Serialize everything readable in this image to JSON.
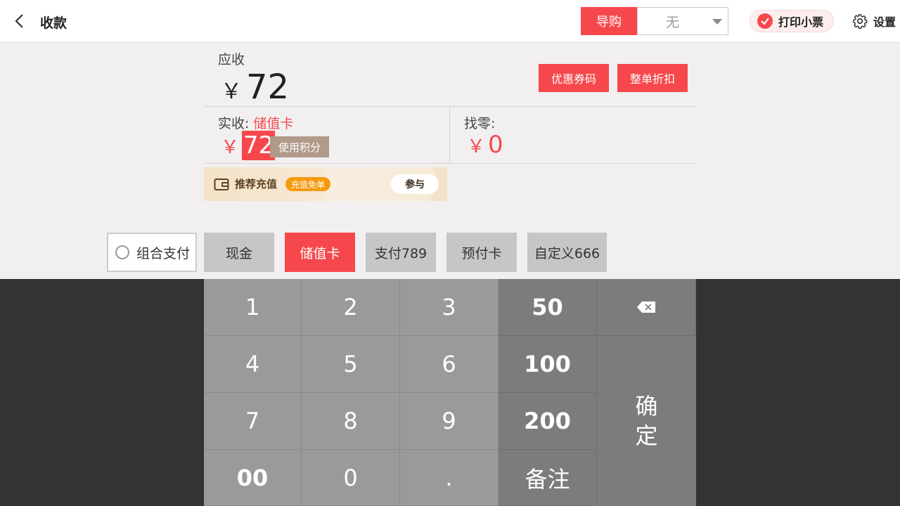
{
  "header": {
    "title": "收款",
    "guide_label": "导购",
    "guide_value": "无",
    "print_label": "打印小票",
    "settings_label": "设置"
  },
  "summary": {
    "receivable_label": "应收",
    "currency": "￥",
    "receivable_amount": "72",
    "coupon_button": "优惠券码",
    "discount_button": "整单折扣",
    "actual_label": "实收:",
    "actual_method": "储值卡",
    "actual_amount": "72",
    "points_button": "使用积分",
    "change_label": "找零:",
    "change_amount": "0"
  },
  "promo": {
    "title": "推荐充值",
    "badge": "充值免单",
    "join_button": "参与"
  },
  "payment": {
    "combo_label": "组合支付",
    "methods": [
      "现金",
      "储值卡",
      "支付789",
      "预付卡",
      "自定义666"
    ],
    "active": "储值卡"
  },
  "keypad": {
    "digits": [
      "1",
      "2",
      "3",
      "4",
      "5",
      "6",
      "7",
      "8",
      "9",
      "00",
      "0",
      "."
    ],
    "quick": [
      "50",
      "100",
      "200"
    ],
    "note": "备注",
    "confirm": "确定"
  },
  "colors": {
    "accent": "#f6484c",
    "key": "#9a9a9a",
    "key_dark": "#7c7c7c"
  }
}
